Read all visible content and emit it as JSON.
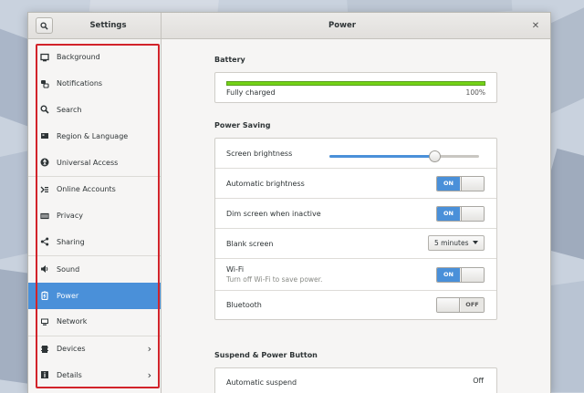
{
  "window": {
    "sidebar_title": "Settings",
    "panel_title": "Power",
    "close_glyph": "✕"
  },
  "sidebar": {
    "items": [
      {
        "label": "Background",
        "icon": "background-icon"
      },
      {
        "label": "Notifications",
        "icon": "notifications-icon"
      },
      {
        "label": "Search",
        "icon": "search-icon"
      },
      {
        "label": "Region & Language",
        "icon": "flag-icon"
      },
      {
        "label": "Universal Access",
        "icon": "accessibility-icon"
      },
      {
        "label": "Online Accounts",
        "icon": "online-accounts-icon"
      },
      {
        "label": "Privacy",
        "icon": "privacy-icon"
      },
      {
        "label": "Sharing",
        "icon": "share-icon"
      },
      {
        "label": "Sound",
        "icon": "speaker-icon"
      },
      {
        "label": "Power",
        "icon": "battery-icon",
        "active": true
      },
      {
        "label": "Network",
        "icon": "network-icon"
      },
      {
        "label": "Devices",
        "icon": "devices-icon",
        "has_submenu": true
      },
      {
        "label": "Details",
        "icon": "info-icon",
        "has_submenu": true
      }
    ]
  },
  "battery": {
    "heading": "Battery",
    "status": "Fully charged",
    "percent_label": "100%",
    "level": 1.0
  },
  "power_saving": {
    "heading": "Power Saving",
    "screen_brightness": {
      "label": "Screen brightness",
      "level": 0.7
    },
    "automatic_brightness": {
      "label": "Automatic brightness",
      "state": "ON"
    },
    "dim_screen": {
      "label": "Dim screen when inactive",
      "state": "ON"
    },
    "blank_screen": {
      "label": "Blank screen",
      "value": "5 minutes"
    },
    "wifi": {
      "label": "Wi-Fi",
      "sublabel": "Turn off Wi-Fi to save power.",
      "state": "ON"
    },
    "bluetooth": {
      "label": "Bluetooth",
      "state": "OFF"
    }
  },
  "suspend": {
    "heading": "Suspend & Power Button",
    "automatic_suspend": {
      "label": "Automatic suspend",
      "value": "Off"
    }
  },
  "colors": {
    "accent": "#4a90d9",
    "battery_fill": "#73d216",
    "highlight": "#d2232a"
  }
}
